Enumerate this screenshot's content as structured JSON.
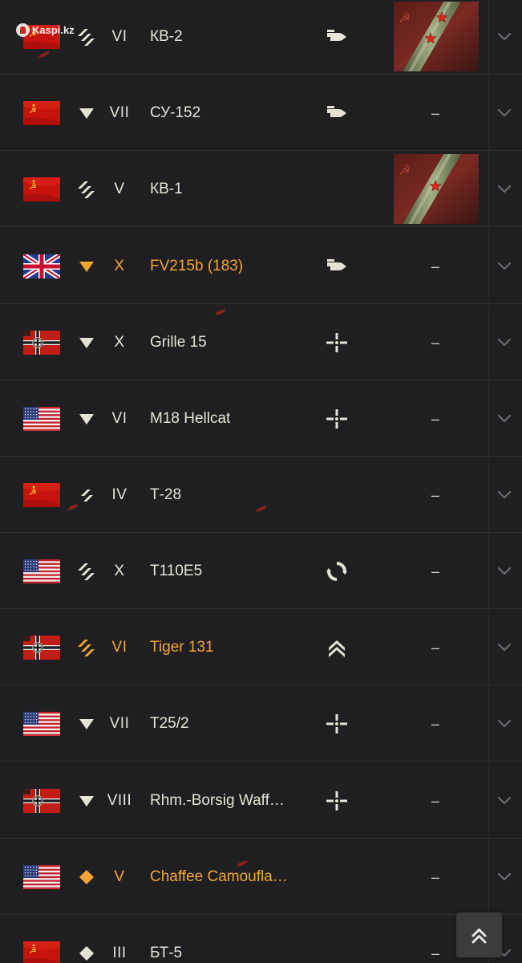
{
  "watermark": {
    "text": "Kaspi.kz"
  },
  "empty_reward": "–",
  "colors": {
    "background": "#1f1f21",
    "text": "#e6e3d6",
    "premium": "#f2a531",
    "divider": "#303033"
  },
  "rows": [
    {
      "nation": "ussr",
      "class": "heavy",
      "tier": "VI",
      "name": "КВ-2",
      "role": "assault-spg",
      "reward": "image",
      "reward_stars": 2,
      "premium": false
    },
    {
      "nation": "ussr",
      "class": "td",
      "tier": "VII",
      "name": "СУ-152",
      "role": "assault-spg",
      "reward": "–",
      "premium": false
    },
    {
      "nation": "ussr",
      "class": "heavy",
      "tier": "V",
      "name": "КВ-1",
      "role": "",
      "reward": "image",
      "reward_stars": 1,
      "premium": false
    },
    {
      "nation": "uk",
      "class": "td",
      "tier": "X",
      "name": "FV215b (183)",
      "role": "assault-spg",
      "reward": "–",
      "premium": true
    },
    {
      "nation": "germany",
      "class": "td",
      "tier": "X",
      "name": "Grille 15",
      "role": "sniper",
      "reward": "–",
      "premium": false
    },
    {
      "nation": "usa",
      "class": "td",
      "tier": "VI",
      "name": "M18 Hellcat",
      "role": "sniper",
      "reward": "–",
      "premium": false
    },
    {
      "nation": "ussr",
      "class": "medium",
      "tier": "IV",
      "name": "Т-28",
      "role": "",
      "reward": "–",
      "premium": false
    },
    {
      "nation": "usa",
      "class": "heavy",
      "tier": "X",
      "name": "T110E5",
      "role": "versatile",
      "reward": "–",
      "premium": false
    },
    {
      "nation": "germany",
      "class": "heavy",
      "tier": "VI",
      "name": "Tiger 131",
      "role": "breakthrough",
      "reward": "–",
      "premium": true
    },
    {
      "nation": "usa",
      "class": "td",
      "tier": "VII",
      "name": "T25/2",
      "role": "sniper",
      "reward": "–",
      "premium": false
    },
    {
      "nation": "germany",
      "class": "td",
      "tier": "VIII",
      "name": "Rhm.-Borsig Waff…",
      "role": "sniper",
      "reward": "–",
      "premium": false
    },
    {
      "nation": "usa",
      "class": "light",
      "tier": "V",
      "name": "Chaffee Camoufla…",
      "role": "",
      "reward": "–",
      "premium": true
    },
    {
      "nation": "ussr",
      "class": "light",
      "tier": "III",
      "name": "БТ-5",
      "role": "",
      "reward": "–",
      "premium": false
    }
  ],
  "scroll_top": {
    "icon": "double-chevron-up-icon"
  }
}
